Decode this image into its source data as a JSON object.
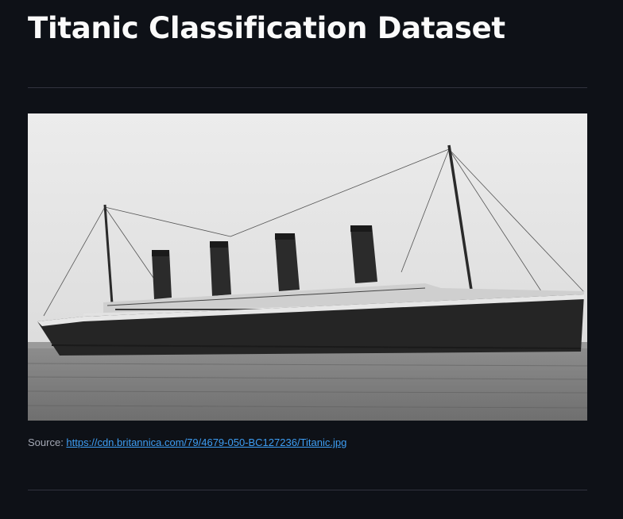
{
  "page": {
    "title": "Titanic Classification Dataset"
  },
  "image": {
    "subject": "Titanic ship photo",
    "icon": "photo-image"
  },
  "caption": {
    "prefix": "Source: ",
    "link_text": "https://cdn.britannica.com/79/4679-050-BC127236/Titanic.jpg"
  },
  "colors": {
    "background": "#0e1117",
    "text": "#fafafa",
    "divider": "#31333f",
    "link": "#3d9df3",
    "caption": "#a3a8b4"
  }
}
